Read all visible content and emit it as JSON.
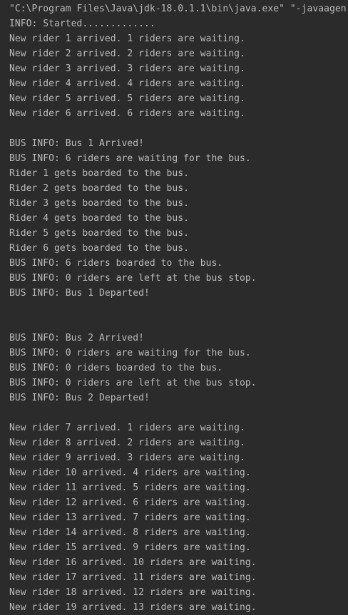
{
  "console": {
    "lines": [
      "\"C:\\Program Files\\Java\\jdk-18.0.1.1\\bin\\java.exe\" \"-javaagen",
      "INFO: Started.............",
      "New rider 1 arrived. 1 riders are waiting.",
      "New rider 2 arrived. 2 riders are waiting.",
      "New rider 3 arrived. 3 riders are waiting.",
      "New rider 4 arrived. 4 riders are waiting.",
      "New rider 5 arrived. 5 riders are waiting.",
      "New rider 6 arrived. 6 riders are waiting.",
      "",
      "BUS INFO: Bus 1 Arrived!",
      "BUS INFO: 6 riders are waiting for the bus.",
      "Rider 1 gets boarded to the bus.",
      "Rider 2 gets boarded to the bus.",
      "Rider 3 gets boarded to the bus.",
      "Rider 4 gets boarded to the bus.",
      "Rider 5 gets boarded to the bus.",
      "Rider 6 gets boarded to the bus.",
      "BUS INFO: 6 riders boarded to the bus.",
      "BUS INFO: 0 riders are left at the bus stop.",
      "BUS INFO: Bus 1 Departed!",
      "",
      "",
      "BUS INFO: Bus 2 Arrived!",
      "BUS INFO: 0 riders are waiting for the bus.",
      "BUS INFO: 0 riders boarded to the bus.",
      "BUS INFO: 0 riders are left at the bus stop.",
      "BUS INFO: Bus 2 Departed!",
      "",
      "New rider 7 arrived. 1 riders are waiting.",
      "New rider 8 arrived. 2 riders are waiting.",
      "New rider 9 arrived. 3 riders are waiting.",
      "New rider 10 arrived. 4 riders are waiting.",
      "New rider 11 arrived. 5 riders are waiting.",
      "New rider 12 arrived. 6 riders are waiting.",
      "New rider 13 arrived. 7 riders are waiting.",
      "New rider 14 arrived. 8 riders are waiting.",
      "New rider 15 arrived. 9 riders are waiting.",
      "New rider 16 arrived. 10 riders are waiting.",
      "New rider 17 arrived. 11 riders are waiting.",
      "New rider 18 arrived. 12 riders are waiting.",
      "New rider 19 arrived. 13 riders are waiting."
    ]
  },
  "colors": {
    "background": "#2b2b2b",
    "text": "#bbbbbb"
  }
}
